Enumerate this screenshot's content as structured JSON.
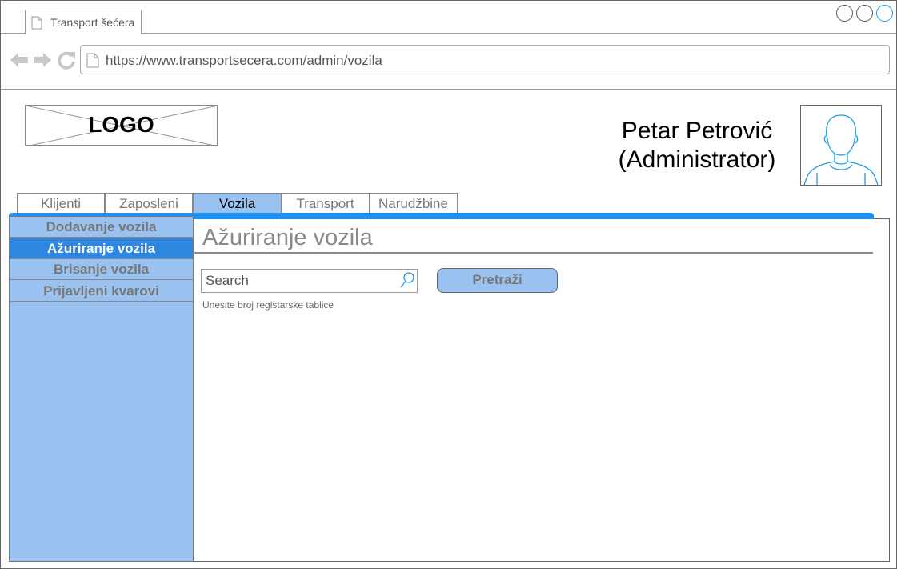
{
  "browser": {
    "tab_title": "Transport šećera",
    "url": "https://www.transportsecera.com/admin/vozila",
    "icons": {
      "back": "arrow-left-icon",
      "forward": "arrow-right-icon",
      "reload": "reload-icon",
      "page": "document-icon"
    }
  },
  "header": {
    "logo_text": "LOGO",
    "user_name": "Petar Petrović",
    "user_role": "(Administrator)"
  },
  "nav": {
    "tabs": [
      {
        "label": "Klijenti"
      },
      {
        "label": "Zaposleni"
      },
      {
        "label": "Vozila",
        "active": true
      },
      {
        "label": "Transport"
      },
      {
        "label": "Narudžbine"
      }
    ]
  },
  "sidebar": {
    "items": [
      {
        "label": "Dodavanje vozila"
      },
      {
        "label": "Ažuriranje vozila",
        "active": true
      },
      {
        "label": "Brisanje  vozila"
      },
      {
        "label": "Prijavljeni kvarovi"
      }
    ]
  },
  "main": {
    "title": "Ažuriranje vozila",
    "search": {
      "placeholder": "Search",
      "value": "",
      "hint": "Unesite broj registarske tablice",
      "button_label": "Pretraži"
    }
  },
  "colors": {
    "accent": "#1e90f0",
    "sidebar_bg": "#99c2f0",
    "active_item": "#2e86e0"
  }
}
